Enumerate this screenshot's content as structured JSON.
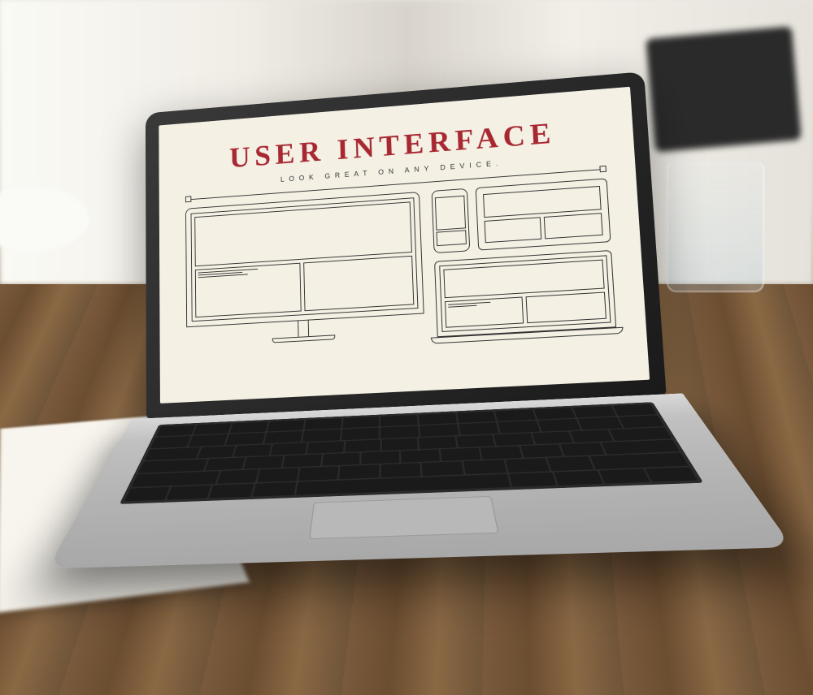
{
  "screen": {
    "title": "USER INTERFACE",
    "subtitle": "LOOK GREAT ON ANY DEVICE."
  }
}
